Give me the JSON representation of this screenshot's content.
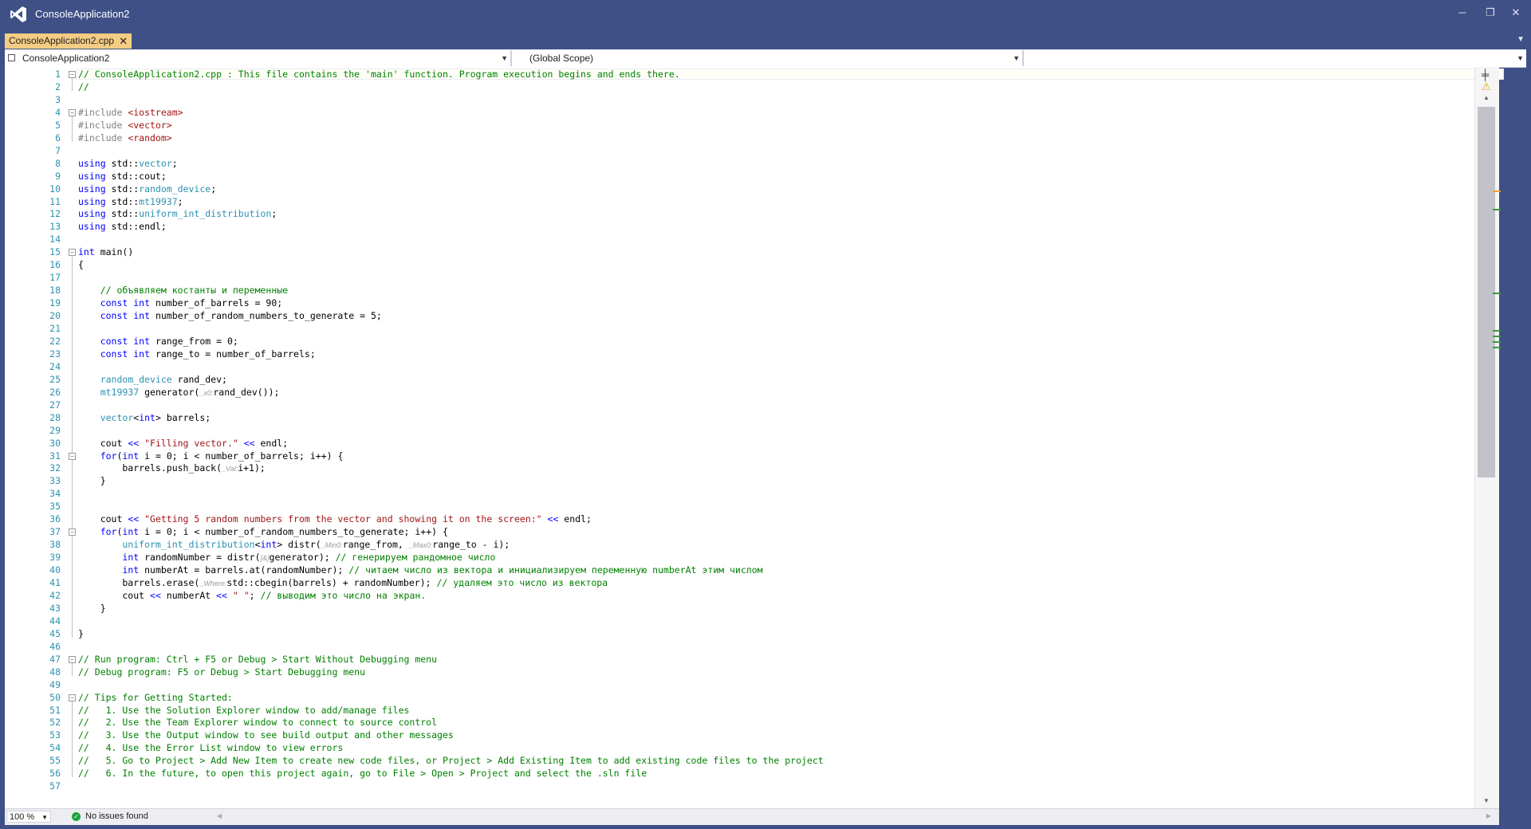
{
  "app": {
    "title": "ConsoleApplication2"
  },
  "window_controls": {
    "minimize": "─",
    "restore": "❐",
    "close": "✕"
  },
  "tab": {
    "label": "ConsoleApplication2.cpp",
    "close": "✕"
  },
  "nav": {
    "project": "ConsoleApplication2",
    "scope": "(Global Scope)",
    "member": ""
  },
  "status": {
    "zoom": "100 %",
    "issues": "No issues found"
  },
  "colors": {
    "keyword": "#0000ff",
    "comment": "#008000",
    "string": "#a31515",
    "type": "#2b91af",
    "line_number": "#2b91af",
    "preprocessor": "#808080"
  },
  "code": {
    "lines": [
      [
        [
          "c",
          "// ConsoleApplication2.cpp : This file contains the 'main' function. Program execution begins and ends there."
        ]
      ],
      [
        [
          "c",
          "//"
        ]
      ],
      [],
      [
        [
          "p",
          "#include "
        ],
        [
          "s",
          "<iostream>"
        ]
      ],
      [
        [
          "p",
          "#include "
        ],
        [
          "s",
          "<vector>"
        ]
      ],
      [
        [
          "p",
          "#include "
        ],
        [
          "s",
          "<random>"
        ]
      ],
      [],
      [
        [
          "k",
          "using "
        ],
        [
          "n",
          "std::"
        ],
        [
          "t",
          "vector"
        ],
        [
          "n",
          ";"
        ]
      ],
      [
        [
          "k",
          "using "
        ],
        [
          "n",
          "std::cout;"
        ]
      ],
      [
        [
          "k",
          "using "
        ],
        [
          "n",
          "std::"
        ],
        [
          "t",
          "random_device"
        ],
        [
          "n",
          ";"
        ]
      ],
      [
        [
          "k",
          "using "
        ],
        [
          "n",
          "std::"
        ],
        [
          "t",
          "mt19937"
        ],
        [
          "n",
          ";"
        ]
      ],
      [
        [
          "k",
          "using "
        ],
        [
          "n",
          "std::"
        ],
        [
          "t",
          "uniform_int_distribution"
        ],
        [
          "n",
          ";"
        ]
      ],
      [
        [
          "k",
          "using "
        ],
        [
          "n",
          "std::endl;"
        ]
      ],
      [],
      [
        [
          "k",
          "int "
        ],
        [
          "n",
          "main()"
        ]
      ],
      [
        [
          "n",
          "{"
        ]
      ],
      [],
      [
        [
          "n",
          "    "
        ],
        [
          "c",
          "// объявляем костанты и переменные"
        ]
      ],
      [
        [
          "n",
          "    "
        ],
        [
          "k",
          "const int "
        ],
        [
          "n",
          "number_of_barrels = 90;"
        ]
      ],
      [
        [
          "n",
          "    "
        ],
        [
          "k",
          "const int "
        ],
        [
          "n",
          "number_of_random_numbers_to_generate = 5;"
        ]
      ],
      [],
      [
        [
          "n",
          "    "
        ],
        [
          "k",
          "const int "
        ],
        [
          "n",
          "range_from = 0;"
        ]
      ],
      [
        [
          "n",
          "    "
        ],
        [
          "k",
          "const int "
        ],
        [
          "n",
          "range_to = number_of_barrels;"
        ]
      ],
      [],
      [
        [
          "n",
          "    "
        ],
        [
          "t",
          "random_device "
        ],
        [
          "n",
          "rand_dev;"
        ]
      ],
      [
        [
          "n",
          "    "
        ],
        [
          "t",
          "mt19937 "
        ],
        [
          "n",
          "generator("
        ],
        [
          "h",
          "_x0:"
        ],
        [
          "n",
          "rand_dev());"
        ]
      ],
      [],
      [
        [
          "n",
          "    "
        ],
        [
          "t",
          "vector"
        ],
        [
          "n",
          "<"
        ],
        [
          "k",
          "int"
        ],
        [
          "n",
          "> barrels;"
        ]
      ],
      [],
      [
        [
          "n",
          "    cout "
        ],
        [
          "o",
          "<< "
        ],
        [
          "s",
          "\"Filling vector.\""
        ],
        [
          "o",
          " << "
        ],
        [
          "n",
          "endl;"
        ]
      ],
      [
        [
          "n",
          "    "
        ],
        [
          "k",
          "for"
        ],
        [
          "n",
          "("
        ],
        [
          "k",
          "int "
        ],
        [
          "n",
          "i = 0; i < number_of_barrels; i++) {"
        ]
      ],
      [
        [
          "n",
          "        barrels.push_back("
        ],
        [
          "h",
          "_Val:"
        ],
        [
          "n",
          "i+1);"
        ]
      ],
      [
        [
          "n",
          "    }"
        ]
      ],
      [],
      [],
      [
        [
          "n",
          "    cout "
        ],
        [
          "o",
          "<< "
        ],
        [
          "s",
          "\"Getting 5 random numbers from the vector and showing it on the screen:\""
        ],
        [
          "o",
          " << "
        ],
        [
          "n",
          "endl;"
        ]
      ],
      [
        [
          "n",
          "    "
        ],
        [
          "k",
          "for"
        ],
        [
          "n",
          "("
        ],
        [
          "k",
          "int "
        ],
        [
          "n",
          "i = 0; i < number_of_random_numbers_to_generate; i++) {"
        ]
      ],
      [
        [
          "n",
          "        "
        ],
        [
          "t",
          "uniform_int_distribution"
        ],
        [
          "n",
          "<"
        ],
        [
          "k",
          "int"
        ],
        [
          "n",
          "> distr("
        ],
        [
          "h",
          "_Min0:"
        ],
        [
          "n",
          "range_from, "
        ],
        [
          "h",
          "_Max0:"
        ],
        [
          "n",
          "range_to - i);"
        ]
      ],
      [
        [
          "n",
          "        "
        ],
        [
          "k",
          "int "
        ],
        [
          "n",
          "randomNumber = distr("
        ],
        [
          "h",
          "[&]"
        ],
        [
          "n",
          "generator); "
        ],
        [
          "c",
          "// генерируем рандомное число"
        ]
      ],
      [
        [
          "n",
          "        "
        ],
        [
          "k",
          "int "
        ],
        [
          "n",
          "numberAt = barrels.at(randomNumber); "
        ],
        [
          "c",
          "// читаем число из вектора и инициализируем переменную numberAt этим числом"
        ]
      ],
      [
        [
          "n",
          "        barrels.erase("
        ],
        [
          "h",
          "_Where:"
        ],
        [
          "n",
          "std::cbegin(barrels) + randomNumber); "
        ],
        [
          "c",
          "// удаляем это число из вектора"
        ]
      ],
      [
        [
          "n",
          "        cout "
        ],
        [
          "o",
          "<< "
        ],
        [
          "n",
          "numberAt "
        ],
        [
          "o",
          "<< "
        ],
        [
          "s",
          "\" \""
        ],
        [
          "n",
          "; "
        ],
        [
          "c",
          "// выводим это число на экран."
        ]
      ],
      [
        [
          "n",
          "    }"
        ]
      ],
      [],
      [
        [
          "n",
          "}"
        ]
      ],
      [],
      [
        [
          "c",
          "// Run program: Ctrl + F5 or Debug > Start Without Debugging menu"
        ]
      ],
      [
        [
          "c",
          "// Debug program: F5 or Debug > Start Debugging menu"
        ]
      ],
      [],
      [
        [
          "c",
          "// Tips for Getting Started:"
        ]
      ],
      [
        [
          "c",
          "//   1. Use the Solution Explorer window to add/manage files"
        ]
      ],
      [
        [
          "c",
          "//   2. Use the Team Explorer window to connect to source control"
        ]
      ],
      [
        [
          "c",
          "//   3. Use the Output window to see build output and other messages"
        ]
      ],
      [
        [
          "c",
          "//   4. Use the Error List window to view errors"
        ]
      ],
      [
        [
          "c",
          "//   5. Go to Project > Add New Item to create new code files, or Project > Add Existing Item to add existing code files to the project"
        ]
      ],
      [
        [
          "c",
          "//   6. In the future, to open this project again, go to File > Open > Project and select the .sln file"
        ]
      ],
      []
    ]
  }
}
